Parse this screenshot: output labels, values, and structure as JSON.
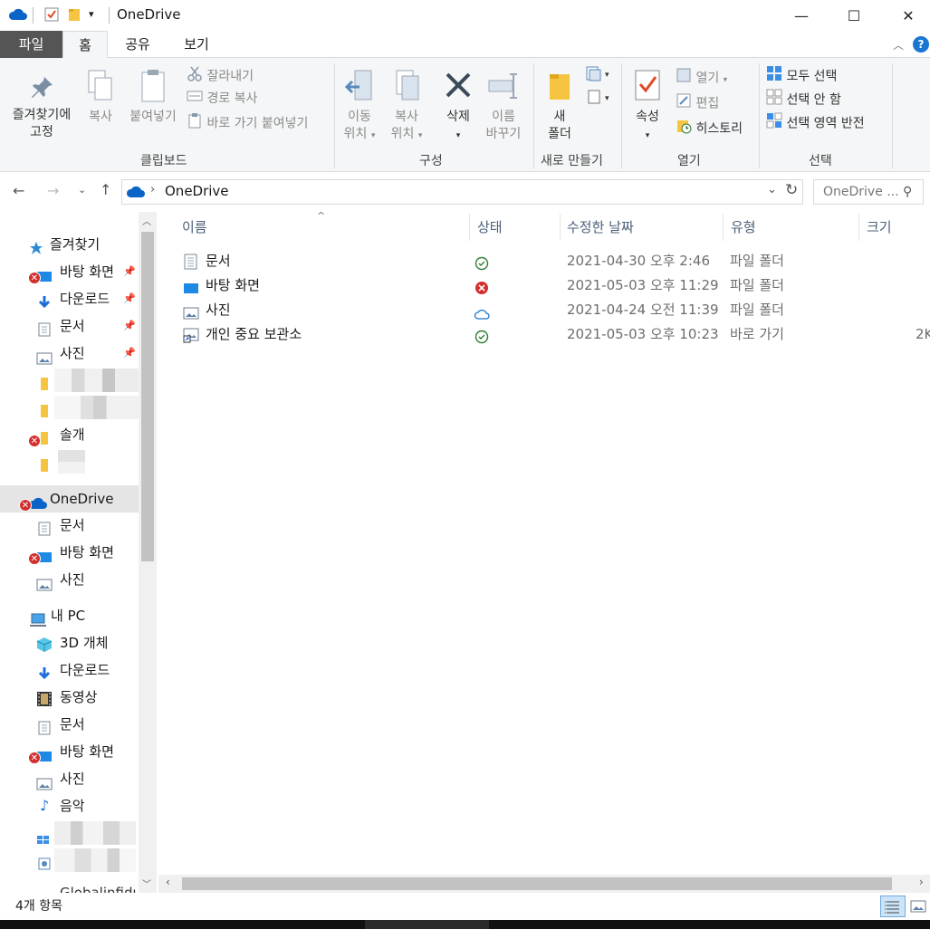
{
  "window": {
    "title": "OneDrive",
    "minimize": "—",
    "maximize": "☐",
    "close": "✕"
  },
  "tabs": [
    "파일",
    "홈",
    "공유",
    "보기"
  ],
  "ribbon": {
    "clipboard": {
      "label": "클립보드",
      "pin_line1": "즐겨찾기에",
      "pin_line2": "고정",
      "copy": "복사",
      "paste": "붙여넣기",
      "cut": "잘라내기",
      "copy_path": "경로 복사",
      "paste_shortcut": "바로 가기 붙여넣기"
    },
    "organize": {
      "label": "구성",
      "move_line1": "이동",
      "move_line2": "위치",
      "copyto_line1": "복사",
      "copyto_line2": "위치",
      "delete": "삭제",
      "rename_line1": "이름",
      "rename_line2": "바꾸기"
    },
    "new": {
      "label": "새로 만들기",
      "folder_line1": "새",
      "folder_line2": "폴더"
    },
    "open": {
      "label": "열기",
      "properties": "속성",
      "open": "열기",
      "edit": "편집",
      "history": "히스토리"
    },
    "select": {
      "label": "선택",
      "select_all": "모두 선택",
      "select_none": "선택 안 함",
      "invert": "선택 영역 반전"
    }
  },
  "address": {
    "path": "OneDrive",
    "search_placeholder": "OneDrive ..."
  },
  "nav": {
    "favorites": "즐겨찾기",
    "fav_desktop": "바탕 화면",
    "fav_downloads": "다운로드",
    "fav_docs": "문서",
    "fav_pictures": "사진",
    "fav_sol": "솔개",
    "onedrive": "OneDrive",
    "od_docs": "문서",
    "od_desktop": "바탕 화면",
    "od_pictures": "사진",
    "pc": "내 PC",
    "pc_3d": "3D 개체",
    "pc_downloads": "다운로드",
    "pc_videos": "동영상",
    "pc_docs": "문서",
    "pc_desktop": "바탕 화면",
    "pc_pictures": "사진",
    "pc_music": "음악",
    "partial": "Globalinfidud"
  },
  "columns": {
    "name": "이름",
    "status": "상태",
    "modified": "수정한 날짜",
    "type": "유형",
    "size": "크기"
  },
  "files": [
    {
      "name": "문서",
      "status": "synced",
      "modified": "2021-04-30 오후 2:46",
      "type": "파일 폴더",
      "size": ""
    },
    {
      "name": "바탕 화면",
      "status": "error",
      "modified": "2021-05-03 오후 11:29",
      "type": "파일 폴더",
      "size": ""
    },
    {
      "name": "사진",
      "status": "cloud",
      "modified": "2021-04-24 오전 11:39",
      "type": "파일 폴더",
      "size": ""
    },
    {
      "name": "개인 중요 보관소",
      "status": "synced",
      "modified": "2021-05-03 오후 10:23",
      "type": "바로 가기",
      "size": "2K"
    }
  ],
  "statusbar": {
    "count": "4개 항목"
  },
  "colors": {
    "accent": "#0078d7",
    "error": "#d32f2f",
    "synced": "#2e7d32",
    "file_tab": "#555555"
  }
}
